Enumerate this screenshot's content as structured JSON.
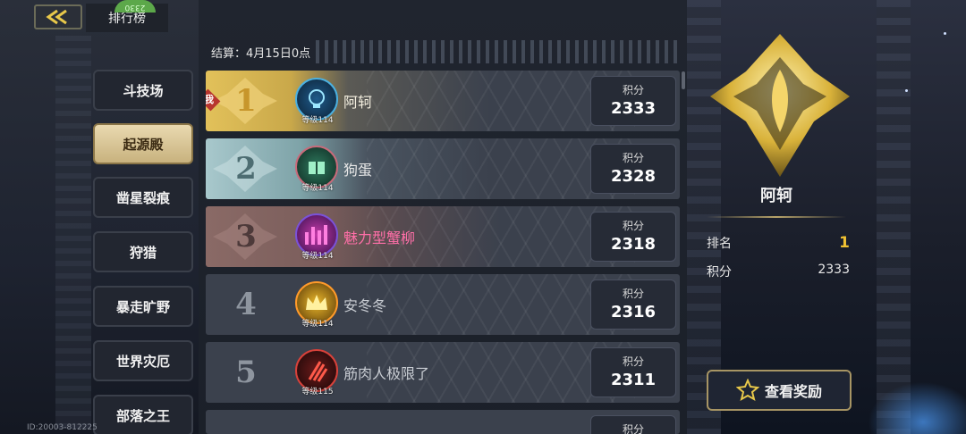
{
  "header": {
    "title": "排行榜",
    "badge_text": "2330"
  },
  "sidebar": {
    "tabs": [
      {
        "label": "斗技场",
        "active": false
      },
      {
        "label": "起源殿",
        "active": true
      },
      {
        "label": "凿星裂痕",
        "active": false
      },
      {
        "label": "狩猎",
        "active": false
      },
      {
        "label": "暴走旷野",
        "active": false
      },
      {
        "label": "世界灾厄",
        "active": false
      },
      {
        "label": "部落之王",
        "active": false
      }
    ]
  },
  "settle": {
    "text": "结算：4月15日0点"
  },
  "leaderboard": {
    "me_label": "我",
    "score_label": "积分",
    "rows": [
      {
        "rank": "1",
        "name": "阿轲",
        "level": "等级114",
        "score": "2333"
      },
      {
        "rank": "2",
        "name": "狗蛋",
        "level": "等级114",
        "score": "2328"
      },
      {
        "rank": "3",
        "name": "魅力型蟹柳",
        "level": "等级114",
        "score": "2318"
      },
      {
        "rank": "4",
        "name": "安冬冬",
        "level": "等级114",
        "score": "2316"
      },
      {
        "rank": "5",
        "name": "筋肉人极限了",
        "level": "等级115",
        "score": "2311"
      }
    ],
    "partial_row_score_label": "积分"
  },
  "profile": {
    "name": "阿轲",
    "rank_label": "排名",
    "rank_value": "1",
    "score_label": "积分",
    "score_value": "2333",
    "reward_button": "查看奖励"
  },
  "footer": {
    "id_text": "ID:20003-812225"
  },
  "colors": {
    "gold": "#f1c232",
    "rank1_bg": "#d9b650",
    "rank2_bg": "#8fb3b8",
    "rank3_bg": "#8a6a68",
    "row_bg": "#3b414d"
  }
}
